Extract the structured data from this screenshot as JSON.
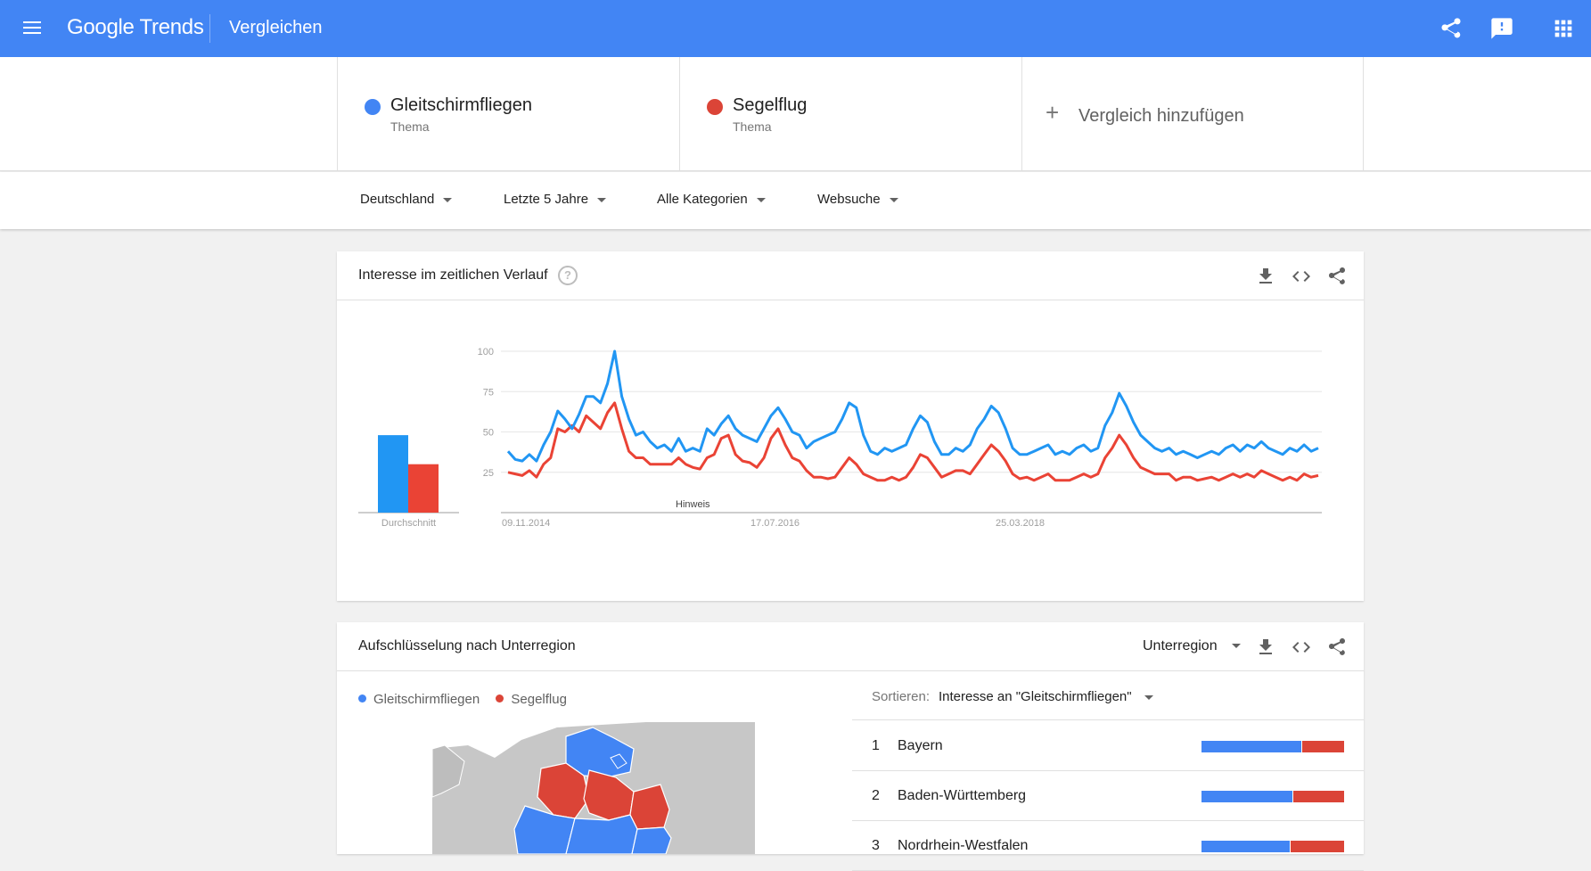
{
  "header": {
    "app_title": "Google Trends",
    "logo_word_1": "Google",
    "logo_word_2": "Trends",
    "page_title": "Vergleichen"
  },
  "terms": [
    {
      "name": "Gleitschirmfliegen",
      "type": "Thema",
      "color": "#4285f4"
    },
    {
      "name": "Segelflug",
      "type": "Thema",
      "color": "#db4437"
    }
  ],
  "add_term_label": "Vergleich hinzufügen",
  "filters": {
    "region": "Deutschland",
    "period": "Letzte 5 Jahre",
    "category": "Alle Kategorien",
    "search_type": "Websuche"
  },
  "timeline_card": {
    "title": "Interesse im zeitlichen Verlauf",
    "help": "?",
    "average_label": "Durchschnitt",
    "note_label": "Hinweis"
  },
  "chart_data": {
    "type": "line",
    "x_tick_labels": [
      "09.11.2014",
      "17.07.2016",
      "25.03.2018"
    ],
    "y_tick_labels": [
      "25",
      "50",
      "75",
      "100"
    ],
    "ylim": [
      0,
      100
    ],
    "grid": true,
    "series": [
      {
        "name": "Gleitschirmfliegen",
        "color": "#2196f3",
        "values": [
          38,
          33,
          32,
          36,
          32,
          42,
          50,
          63,
          58,
          52,
          61,
          72,
          72,
          68,
          80,
          100,
          72,
          58,
          48,
          50,
          44,
          40,
          42,
          38,
          46,
          38,
          40,
          38,
          52,
          48,
          55,
          60,
          52,
          48,
          46,
          44,
          52,
          60,
          65,
          58,
          50,
          48,
          40,
          44,
          46,
          48,
          50,
          58,
          68,
          65,
          48,
          38,
          36,
          40,
          38,
          40,
          42,
          52,
          60,
          56,
          44,
          36,
          36,
          40,
          38,
          42,
          52,
          58,
          66,
          62,
          52,
          40,
          36,
          36,
          38,
          40,
          42,
          36,
          38,
          36,
          40,
          42,
          38,
          40,
          54,
          62,
          74,
          66,
          56,
          48,
          44,
          40,
          38,
          40,
          36,
          38,
          36,
          34,
          36,
          38,
          36,
          40,
          42,
          38,
          42,
          40,
          44,
          40,
          38,
          36,
          40,
          38,
          42,
          38,
          40
        ]
      },
      {
        "name": "Segelflug",
        "color": "#ea4335",
        "values": [
          25,
          24,
          23,
          26,
          22,
          30,
          34,
          52,
          50,
          54,
          50,
          60,
          56,
          52,
          62,
          68,
          52,
          38,
          34,
          34,
          30,
          30,
          30,
          30,
          34,
          30,
          28,
          27,
          34,
          36,
          46,
          48,
          36,
          32,
          31,
          28,
          34,
          46,
          52,
          42,
          34,
          32,
          26,
          22,
          22,
          21,
          22,
          28,
          34,
          30,
          24,
          22,
          20,
          20,
          22,
          20,
          22,
          28,
          36,
          34,
          28,
          22,
          24,
          26,
          26,
          24,
          30,
          36,
          42,
          38,
          32,
          24,
          21,
          22,
          20,
          22,
          24,
          20,
          20,
          20,
          22,
          24,
          22,
          24,
          34,
          40,
          48,
          42,
          34,
          28,
          26,
          24,
          24,
          24,
          20,
          22,
          22,
          20,
          21,
          22,
          20,
          22,
          24,
          22,
          24,
          22,
          26,
          24,
          22,
          20,
          22,
          20,
          24,
          22,
          23
        ]
      }
    ],
    "average": {
      "Gleitschirmfliegen": 48,
      "Segelflug": 30
    }
  },
  "region_card": {
    "title": "Aufschlüsselung nach Unterregion",
    "region_select": "Unterregion",
    "legend": [
      "Gleitschirmfliegen",
      "Segelflug"
    ],
    "sort_label": "Sortieren:",
    "sort_value": "Interesse an \"Gleitschirmfliegen\"",
    "rows": [
      {
        "rank": "1",
        "name": "Bayern",
        "share_a": 0.7
      },
      {
        "rank": "2",
        "name": "Baden-Württemberg",
        "share_a": 0.64
      },
      {
        "rank": "3",
        "name": "Nordrhein-Westfalen",
        "share_a": 0.62
      }
    ]
  }
}
